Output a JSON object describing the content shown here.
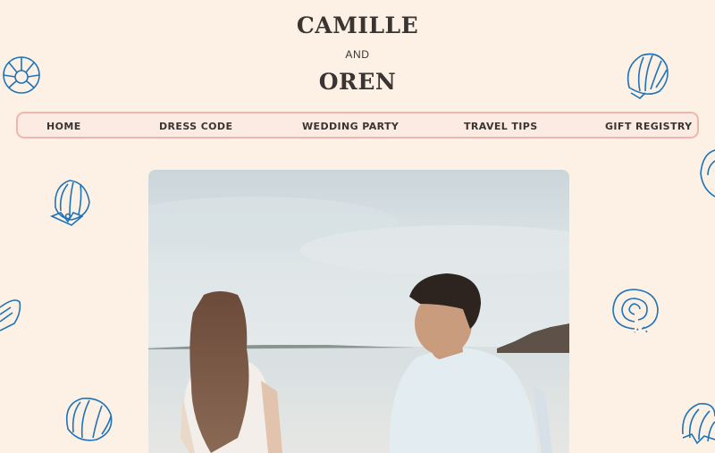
{
  "couple": {
    "first_name": "CAMILLE",
    "and_word": "AND",
    "second_name": "OREN"
  },
  "nav": {
    "items": [
      {
        "label": "HOME"
      },
      {
        "label": "DRESS CODE"
      },
      {
        "label": "WEDDING PARTY"
      },
      {
        "label": "TRAVEL TIPS"
      },
      {
        "label": "GIFT REGISTRY"
      }
    ]
  },
  "colors": {
    "background": "#fdf0e4",
    "nav_border": "#efb6ad",
    "shell_outline": "#1f73b8",
    "text": "#3a3432"
  },
  "decorations": {
    "shell_icons": [
      "scallop-shell-icon",
      "conch-shell-icon",
      "spiral-shell-icon",
      "clam-shell-icon"
    ]
  },
  "hero": {
    "image": "couple-on-beach-photo"
  }
}
